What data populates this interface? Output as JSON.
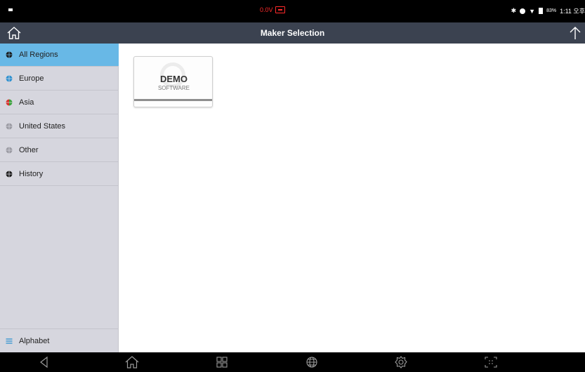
{
  "status_bar": {
    "voltage": "0.0V",
    "battery_percent": "83%",
    "time": "1:11 오후"
  },
  "title_bar": {
    "title": "Maker Selection"
  },
  "sidebar": {
    "items": [
      {
        "label": "All Regions",
        "icon": "globe-icon",
        "active": true
      },
      {
        "label": "Europe",
        "icon": "globe-europe-icon",
        "active": false
      },
      {
        "label": "Asia",
        "icon": "globe-asia-icon",
        "active": false
      },
      {
        "label": "United States",
        "icon": "globe-us-icon",
        "active": false
      },
      {
        "label": "Other",
        "icon": "globe-other-icon",
        "active": false
      },
      {
        "label": "History",
        "icon": "globe-history-icon",
        "active": false
      }
    ],
    "alphabet_label": "Alphabet"
  },
  "content": {
    "makers": [
      {
        "title": "DEMO",
        "subtitle": "SOFTWARE"
      }
    ]
  },
  "colors": {
    "status_bar_bg": "#000000",
    "title_bar_bg": "#3b4250",
    "sidebar_bg": "#d6d6de",
    "active_item_bg": "#68b8e6",
    "voltage_color": "#ff2a2a",
    "alphabet_icon_color": "#2a8fd0"
  },
  "nav_bar": {
    "buttons": [
      "back-icon",
      "home-icon",
      "apps-icon",
      "globe-icon",
      "settings-icon",
      "screenshot-icon"
    ]
  }
}
